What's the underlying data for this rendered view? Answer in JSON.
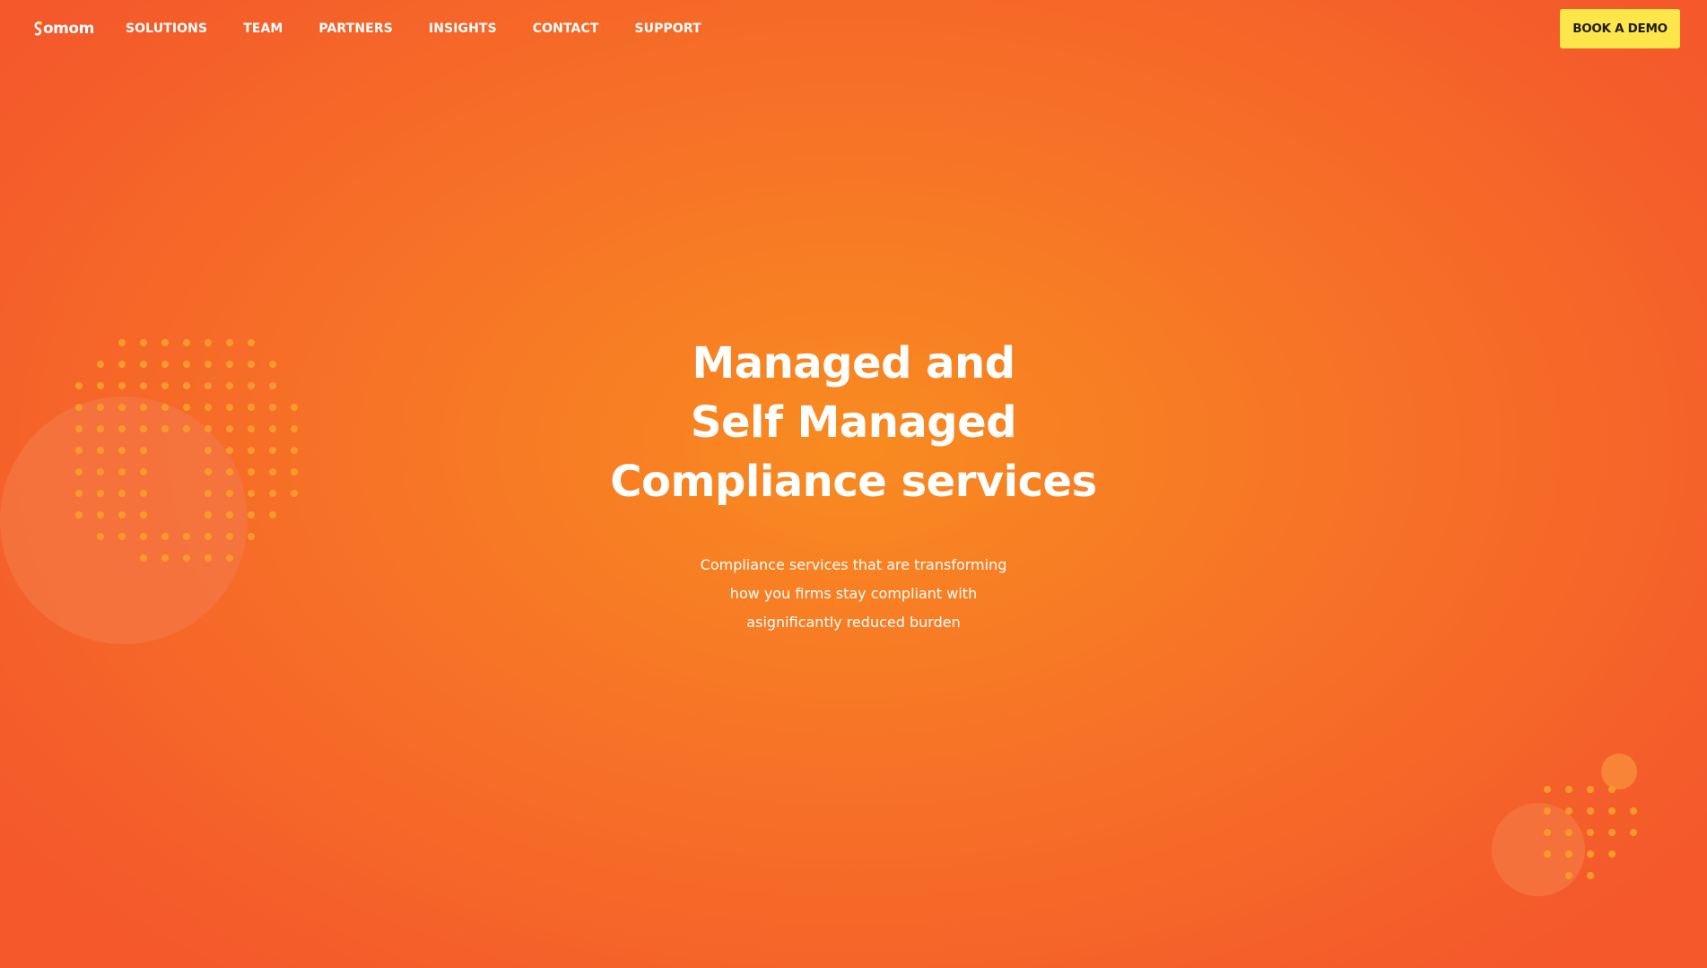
{
  "brand": {
    "name": "omom",
    "accent_color": "#fde64a",
    "background_colors": [
      "#f88b20",
      "#f4582b"
    ]
  },
  "nav": {
    "items": [
      {
        "label": "SOLUTIONS"
      },
      {
        "label": "TEAM"
      },
      {
        "label": "PARTNERS"
      },
      {
        "label": "INSIGHTS"
      },
      {
        "label": "CONTACT"
      },
      {
        "label": "SUPPORT"
      }
    ],
    "cta_label": "BOOK A DEMO"
  },
  "hero": {
    "title_lines": [
      "Managed and",
      "Self Managed",
      "Compliance services"
    ],
    "subtitle_lines": [
      "Compliance services that are transforming",
      "how you firms stay compliant with",
      "asignificantly reduced burden"
    ]
  },
  "decorations": {
    "left": "dot-pattern-with-circle",
    "right": "dot-pattern-with-circles"
  }
}
